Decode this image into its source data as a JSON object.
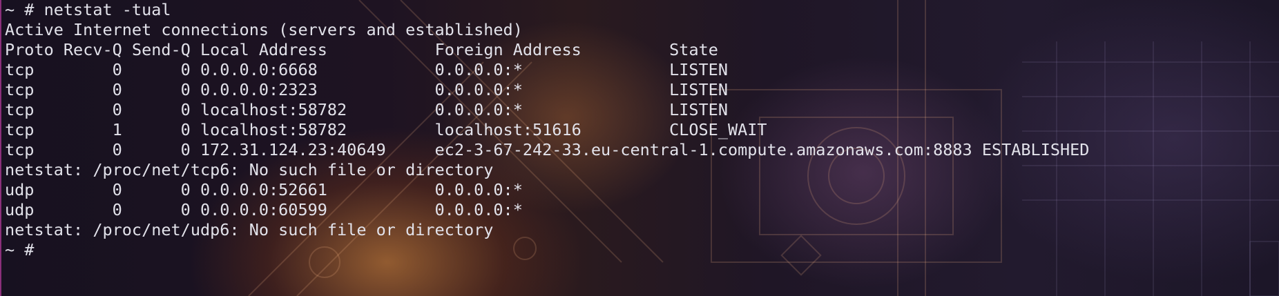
{
  "terminal": {
    "prompt_command": "~ # netstat -tual",
    "header_line": "Active Internet connections (servers and established)",
    "columns": {
      "proto": "Proto",
      "recv_q": "Recv-Q",
      "send_q": "Send-Q",
      "local_address": "Local Address",
      "foreign_address": "Foreign Address",
      "state": "State"
    },
    "rows": [
      "tcp        0      0 0.0.0.0:6668            0.0.0.0:*               LISTEN",
      "tcp        0      0 0.0.0.0:2323            0.0.0.0:*               LISTEN",
      "tcp        0      0 localhost:58782         0.0.0.0:*               LISTEN",
      "tcp        1      0 localhost:58782         localhost:51616         CLOSE_WAIT",
      "tcp        0      0 172.31.124.23:40649     ec2-3-67-242-33.eu-central-1.compute.amazonaws.com:8883 ESTABLISHED",
      "netstat: /proc/net/tcp6: No such file or directory",
      "udp        0      0 0.0.0.0:52661           0.0.0.0:*",
      "udp        0      0 0.0.0.0:60599           0.0.0.0:*",
      "netstat: /proc/net/udp6: No such file or directory"
    ],
    "final_prompt": "~ #",
    "colors": {
      "text": "#e2e2ea",
      "border": "#8a2f7a"
    }
  }
}
